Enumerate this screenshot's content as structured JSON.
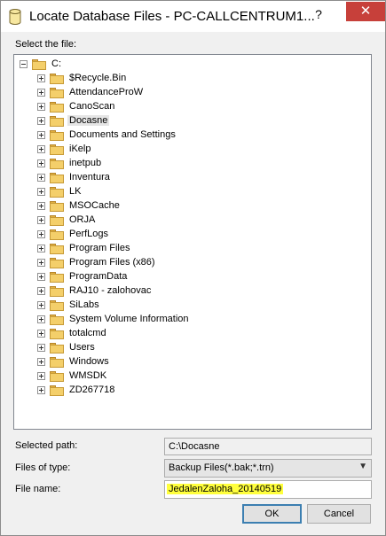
{
  "window": {
    "title": "Locate Database Files - PC-CALLCENTRUM1...",
    "help_label": "?",
    "close_label": "✕"
  },
  "select_label": "Select the file:",
  "tree": {
    "root": "C:",
    "items": [
      "$Recycle.Bin",
      "AttendanceProW",
      "CanoScan",
      "Docasne",
      "Documents and Settings",
      "iKelp",
      "inetpub",
      "Inventura",
      "LK",
      "MSOCache",
      "ORJA",
      "PerfLogs",
      "Program Files",
      "Program Files (x86)",
      "ProgramData",
      "RAJ10 - zalohovac",
      "SiLabs",
      "System Volume Information",
      "totalcmd",
      "Users",
      "Windows",
      "WMSDK",
      "ZD267718"
    ]
  },
  "selected_path": {
    "label": "Selected path:",
    "value": "C:\\Docasne"
  },
  "files_of_type": {
    "label": "Files of type:",
    "value": "Backup Files(*.bak;*.trn)"
  },
  "file_name": {
    "label": "File name:",
    "value": "JedalenZaloha_20140519"
  },
  "buttons": {
    "ok": "OK",
    "cancel": "Cancel"
  },
  "colors": {
    "close_button": "#c7403a",
    "filename_highlight": "#ffff3c",
    "folder": "#f4cf6a"
  },
  "icons": [
    "database-icon",
    "help-icon",
    "close-icon",
    "folder-icon",
    "expand-icon",
    "collapse-icon",
    "dropdown-arrow-icon"
  ]
}
